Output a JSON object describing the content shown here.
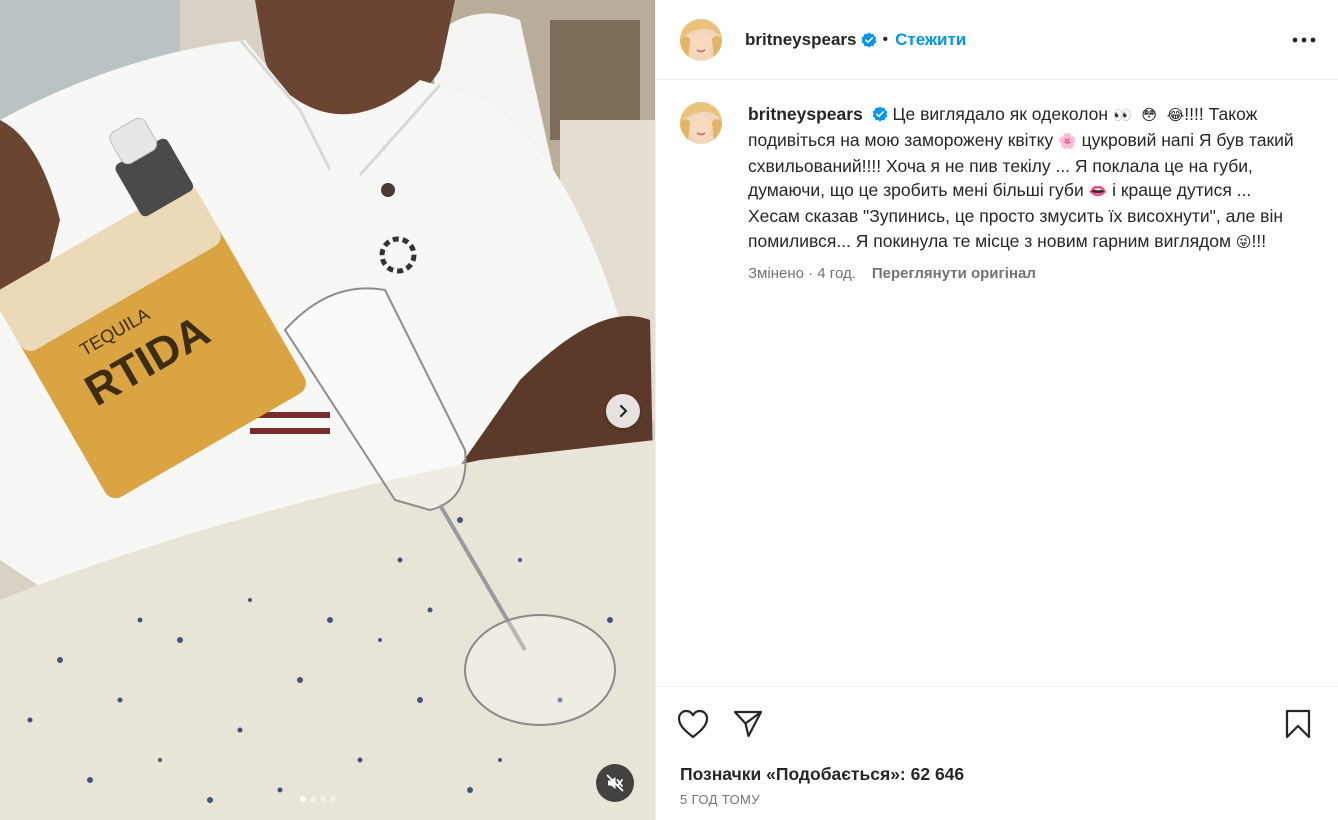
{
  "post": {
    "username": "britneyspears",
    "separator": "•",
    "follow_label": "Стежити",
    "more_icon": "more-horizontal-icon"
  },
  "media": {
    "next_icon": "chevron-right-icon",
    "mute_icon": "muted-speaker-icon",
    "carousel": {
      "count": 4,
      "active": 1
    }
  },
  "caption": {
    "username": "britneyspears",
    "part1": "Це виглядало як одеколон ",
    "emoji1": "👀",
    "emoji2": "😳",
    "emoji3": "😂",
    "part2": "!!!! Також подивіться на мою заморожену квітку ",
    "emoji4": "🌸",
    "part3": " цукровий напі Я був такий схвильований!!!! Хоча я не пив текілу ... Я поклала це на губи, думаючи, що це зробить мені більші губи ",
    "emoji5": "👄",
    "part4": " і краще дутися ... Хесам сказав \"Зупинись, це просто змусить їх висохнути\", але він помилився... Я покинула те місце з новим гарним виглядом ",
    "emoji6": "😜",
    "part5": "!!!",
    "edited": "Змінено · 4 год.",
    "see_original": "Переглянути оригінал"
  },
  "actions": {
    "like_icon": "heart-icon",
    "share_icon": "paper-plane-icon",
    "save_icon": "bookmark-icon"
  },
  "likes_text": "Позначки «Подобається»: 62 646",
  "timestamp": "5 ГОД ТОМУ",
  "colors": {
    "accent": "#0095f6",
    "text": "#262626",
    "muted": "#737373",
    "divider": "#efefef"
  }
}
